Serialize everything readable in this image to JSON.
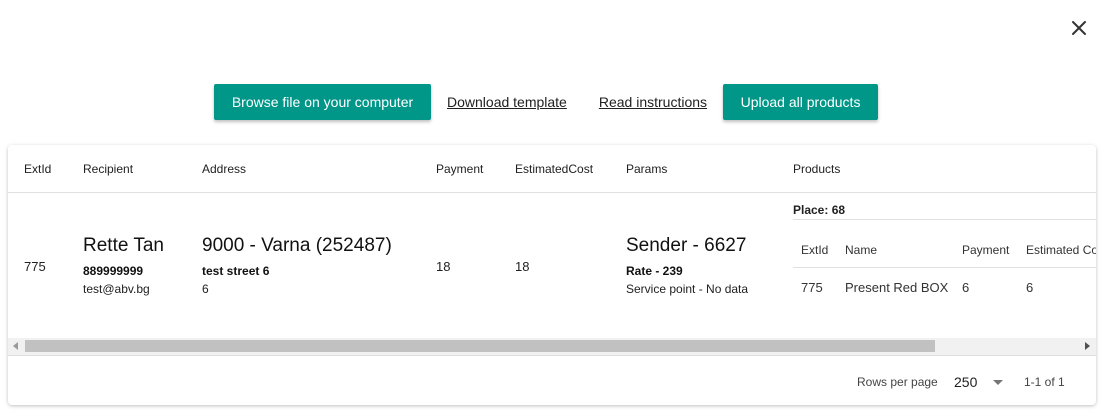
{
  "toolbar": {
    "browse_label": "Browse file on your computer",
    "download_label": "Download template",
    "read_label": "Read instructions",
    "upload_label": "Upload all products"
  },
  "table": {
    "headers": {
      "extid": "ExtId",
      "recipient": "Recipient",
      "address": "Address",
      "payment": "Payment",
      "estimated_cost": "EstimatedCost",
      "params": "Params",
      "products": "Products"
    },
    "row": {
      "extid": "775",
      "recipient_name": "Rette Tan",
      "recipient_phone": "889999999",
      "recipient_email": "test@abv.bg",
      "address_main": "9000 - Varna (252487)",
      "address_street": "test street 6",
      "address_extra": "6",
      "payment": "18",
      "estimated_cost": "18",
      "params_sender": "Sender - 6627",
      "params_rate": "Rate - 239",
      "params_service": "Service point - No data"
    },
    "products": {
      "place": "Place: 68",
      "headers": {
        "extid": "ExtId",
        "name": "Name",
        "payment": "Payment",
        "estimated_cost": "Estimated Co"
      },
      "items": [
        {
          "extid": "775",
          "name": "Present Red BOX",
          "payment": "6",
          "estimated_cost": "6"
        }
      ]
    }
  },
  "pagination": {
    "rows_label": "Rows per page",
    "rows_value": "250",
    "range": "1-1 of 1"
  },
  "colors": {
    "accent": "#009688"
  },
  "icons": {
    "close": "close-icon",
    "dropdown": "chevron-down-icon"
  }
}
